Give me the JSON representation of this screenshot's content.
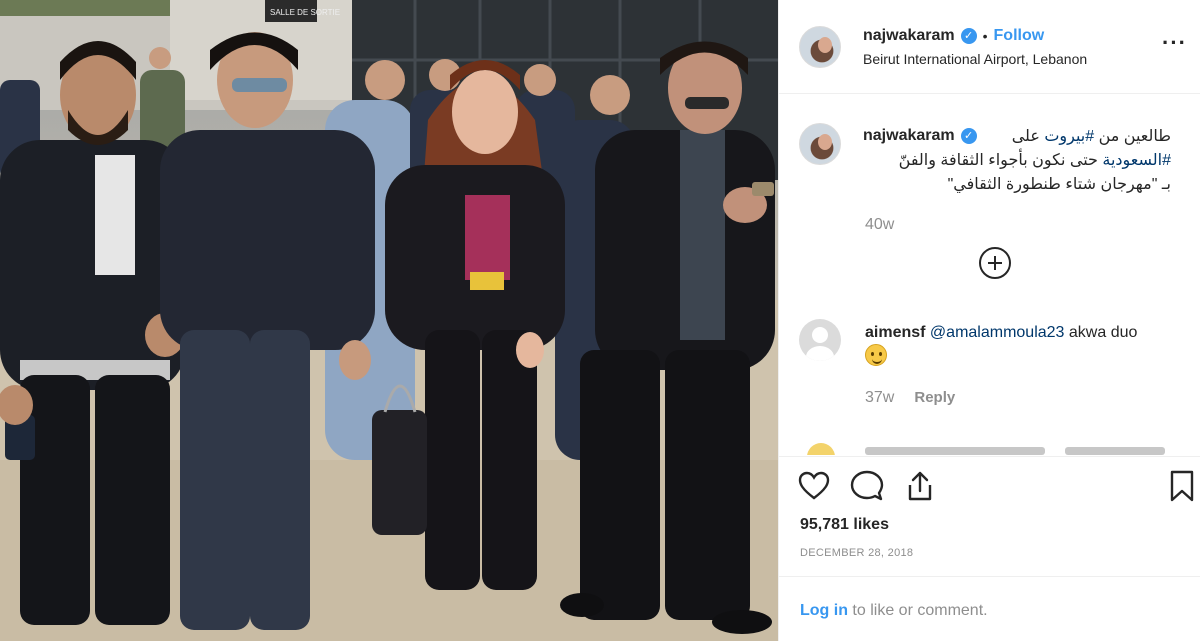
{
  "post": {
    "username": "najwakaram",
    "follow_label": "Follow",
    "location": "Beirut International Airport, Lebanon",
    "more_label": "···"
  },
  "caption": {
    "username": "najwakaram",
    "line1_pre": "طالعين من ",
    "line1_tag": "#بيروت",
    "line1_post": " على",
    "line2_tag": "#السعودية",
    "line2_post": " حتى نكون بأجواء الثقافة والفنّ",
    "line3": "بـ \"مهرجان شتاء طنطورة الثقافي\"",
    "time": "40w"
  },
  "comment": {
    "username": "aimensf",
    "mention": "@amalammoula23",
    "text": " akwa duo",
    "time": "37w",
    "reply_label": "Reply"
  },
  "stats": {
    "likes": "95,781 likes",
    "date": "DECEMBER 28, 2018"
  },
  "login": {
    "link_label": "Log in",
    "suffix": " to like or comment."
  },
  "photo": {
    "sign_text": "SALLE DE SORTIE"
  },
  "icons": {
    "like": "heart-icon",
    "comment": "comment-icon",
    "share": "share-icon",
    "save": "bookmark-icon",
    "load_more": "plus-circle-icon"
  },
  "colors": {
    "link_blue": "#3897f0",
    "hashtag": "#00376b",
    "muted": "#8e8e8e"
  }
}
